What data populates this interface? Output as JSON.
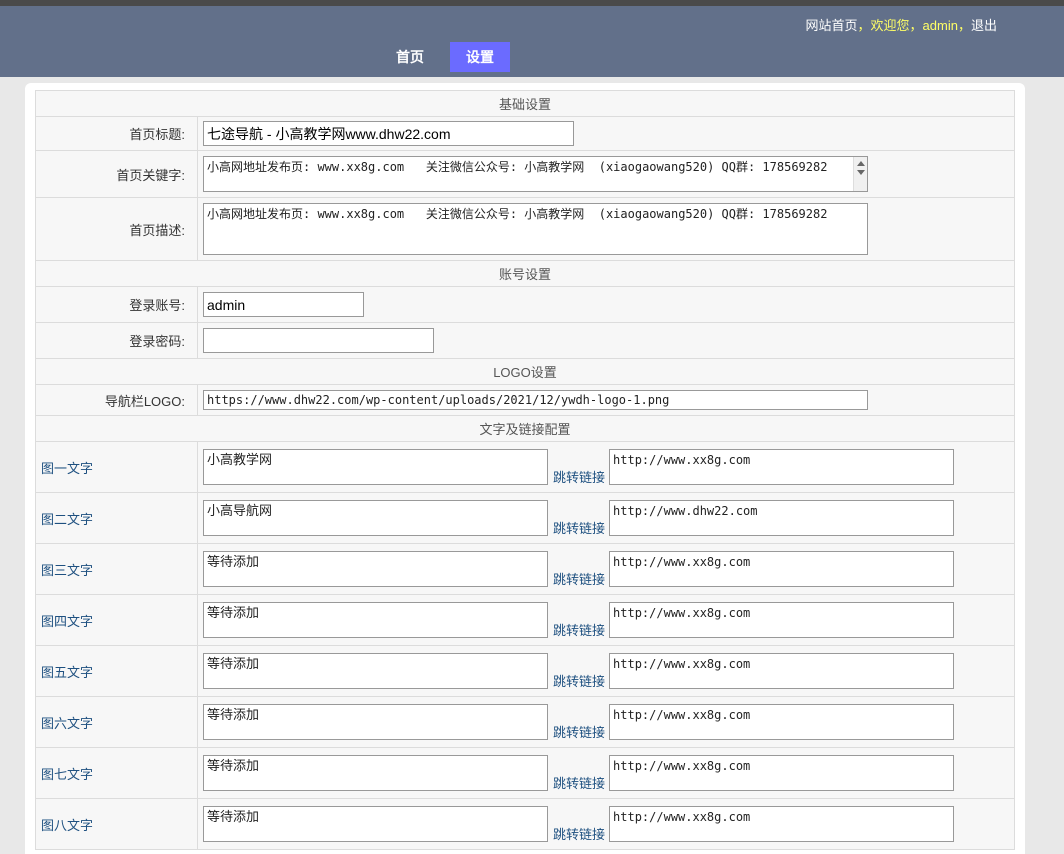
{
  "header": {
    "site_home": "网站首页",
    "comma1": "，",
    "welcome": "欢迎您",
    "comma2": "，",
    "user": "admin",
    "comma3": "，",
    "logout": "退出",
    "nav": {
      "home": "首页",
      "settings": "设置"
    }
  },
  "sections": {
    "basic": "基础设置",
    "account": "账号设置",
    "logo": "LOGO设置",
    "links": "文字及链接配置"
  },
  "basic": {
    "title_label": "首页标题:",
    "title_value": "七途导航 - 小高教学网www.dhw22.com",
    "keywords_label": "首页关键字:",
    "keywords_value": "小高网地址发布页: www.xx8g.com   关注微信公众号: 小高教学网  (xiaogaowang520) QQ群: 178569282",
    "desc_label": "首页描述:",
    "desc_value": "小高网地址发布页: www.xx8g.com   关注微信公众号: 小高教学网  (xiaogaowang520) QQ群: 178569282"
  },
  "account": {
    "username_label": "登录账号:",
    "username_value": "admin",
    "password_label": "登录密码:",
    "password_value": ""
  },
  "logo": {
    "label": "导航栏LOGO:",
    "value": "https://www.dhw22.com/wp-content/uploads/2021/12/ywdh-logo-1.png"
  },
  "jump_label": "跳转链接",
  "pictures": [
    {
      "label": "图一文字",
      "text": "小高教学网",
      "link": "http://www.xx8g.com"
    },
    {
      "label": "图二文字",
      "text": "小高导航网",
      "link": "http://www.dhw22.com"
    },
    {
      "label": "图三文字",
      "text": "等待添加",
      "link": "http://www.xx8g.com"
    },
    {
      "label": "图四文字",
      "text": "等待添加",
      "link": "http://www.xx8g.com"
    },
    {
      "label": "图五文字",
      "text": "等待添加",
      "link": "http://www.xx8g.com"
    },
    {
      "label": "图六文字",
      "text": "等待添加",
      "link": "http://www.xx8g.com"
    },
    {
      "label": "图七文字",
      "text": "等待添加",
      "link": "http://www.xx8g.com"
    },
    {
      "label": "图八文字",
      "text": "等待添加",
      "link": "http://www.xx8g.com"
    }
  ]
}
